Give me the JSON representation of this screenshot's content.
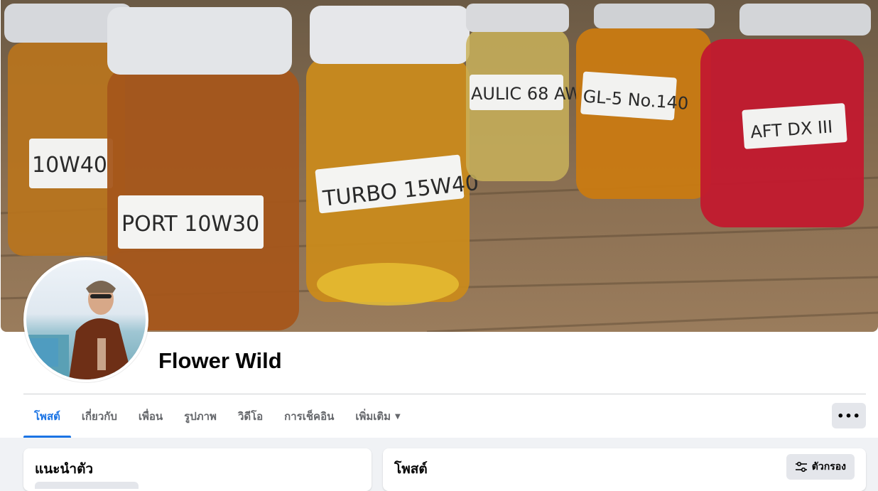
{
  "profile": {
    "name": "Flower Wild"
  },
  "cover": {
    "jar_labels": [
      "10W40",
      "PORT 10W30",
      "TURBO 15W40",
      "AULIC 68 AW",
      "GL-5 No.140",
      "AFT DX III"
    ]
  },
  "tabs": [
    {
      "label": "โพสต์",
      "active": true
    },
    {
      "label": "เกี่ยวกับ",
      "active": false
    },
    {
      "label": "เพื่อน",
      "active": false
    },
    {
      "label": "รูปภาพ",
      "active": false
    },
    {
      "label": "วิดีโอ",
      "active": false
    },
    {
      "label": "การเช็คอิน",
      "active": false
    },
    {
      "label": "เพิ่มเติม",
      "active": false
    }
  ],
  "more_button": {
    "label": "•••"
  },
  "intro_card": {
    "title": "แนะนำตัว"
  },
  "posts_card": {
    "title": "โพสต์",
    "filter_label": "ตัวกรอง"
  },
  "colors": {
    "accent": "#1b74e4",
    "background": "#f0f2f5",
    "button_bg": "#e4e6eb"
  }
}
